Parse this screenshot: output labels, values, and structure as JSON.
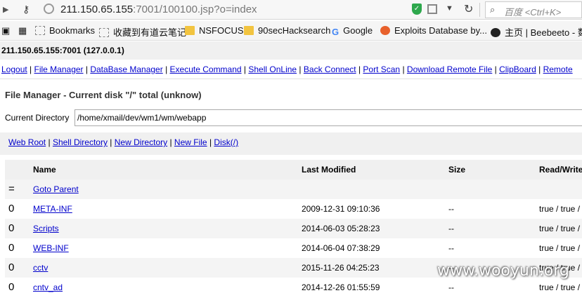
{
  "browser": {
    "url_host": "211.150.65.155",
    "url_rest": ":7001/100100.jsp?o=index",
    "search_placeholder": "百度 <Ctrl+K>"
  },
  "bookmarks": [
    {
      "label": "Bookmarks",
      "icon": "bookmarks-icon"
    },
    {
      "label": "收藏到有道云笔记",
      "icon": "youdao-icon"
    },
    {
      "label": "NSFOCUS",
      "icon": "folder-icon"
    },
    {
      "label": "90secHacksearch",
      "icon": "folder-icon"
    },
    {
      "label": "Google",
      "icon": "google-icon"
    },
    {
      "label": "Exploits Database by...",
      "icon": "exploitdb-icon"
    },
    {
      "label": "主页 | Beebeeto - 数",
      "icon": "beebeeto-icon"
    }
  ],
  "host_line": "211.150.65.155:7001 (127.0.0.1)",
  "nav": [
    "Logout",
    "File Manager",
    "DataBase Manager",
    "Execute Command",
    "Shell OnLine",
    "Back Connect",
    "Port Scan",
    "Download Remote File",
    "ClipBoard",
    "Remote"
  ],
  "file_manager": {
    "title": "File Manager - Current disk \"/\" total (unknow)",
    "current_directory_label": "Current Directory",
    "current_directory_value": "/home/xmail/dev/wm1/wm/webapp",
    "toolbar": [
      "Web Root",
      "Shell Directory",
      "New Directory",
      "New File",
      "Disk(/)"
    ],
    "columns": [
      "Name",
      "Last Modified",
      "Size",
      "Read/Write"
    ],
    "parent": {
      "marker": "=",
      "label": "Goto Parent"
    },
    "rows": [
      {
        "marker": "0",
        "name": "META-INF",
        "modified": "2009-12-31 09:10:36",
        "size": "--",
        "rw": "true / true / "
      },
      {
        "marker": "0",
        "name": "Scripts",
        "modified": "2014-06-03 05:28:23",
        "size": "--",
        "rw": "true / true / "
      },
      {
        "marker": "0",
        "name": "WEB-INF",
        "modified": "2014-06-04 07:38:29",
        "size": "--",
        "rw": "true / true / "
      },
      {
        "marker": "0",
        "name": "cctv",
        "modified": "2015-11-26 04:25:23",
        "size": "--",
        "rw": "true / true / "
      },
      {
        "marker": "0",
        "name": "cntv_ad",
        "modified": "2014-12-26 01:55:59",
        "size": "--",
        "rw": "true / true / "
      }
    ]
  },
  "watermark": "www.wooyun.org"
}
